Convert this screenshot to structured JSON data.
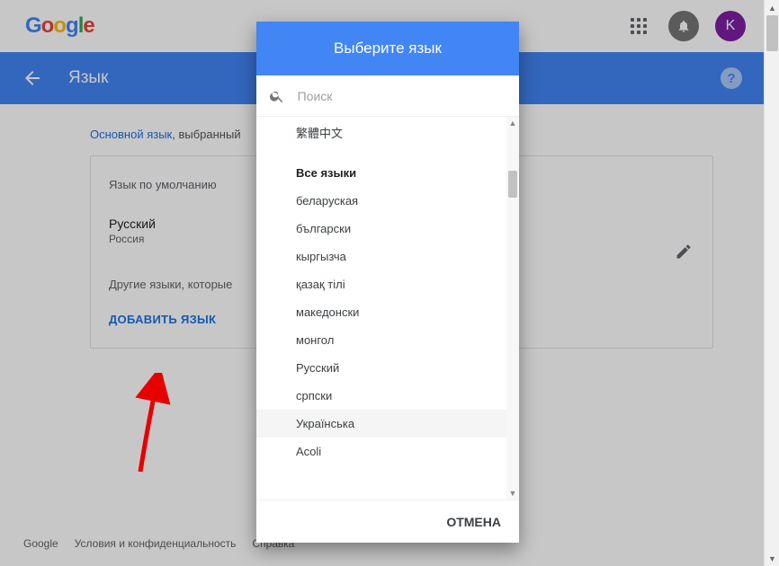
{
  "topbar": {
    "logo_chars": {
      "g1": "G",
      "o1": "o",
      "o2": "o",
      "g2": "g",
      "l1": "l",
      "e1": "e"
    },
    "avatar_initial": "K"
  },
  "header": {
    "title": "Язык"
  },
  "content": {
    "intro_link": "Основной язык",
    "intro_suffix": ", выбранный",
    "card": {
      "heading": "Язык по умолчанию",
      "lang_name": "Русский",
      "lang_sub": "Россия",
      "other_text": "Другие языки, которые",
      "add_label": "ДОБАВИТЬ ЯЗЫК"
    }
  },
  "footer": {
    "brand": "Google",
    "privacy": "Условия и конфиденциальность",
    "help": "Справка"
  },
  "modal": {
    "title": "Выберите язык",
    "search_placeholder": "Поиск",
    "top_item": "繁體中文",
    "section_label": "Все языки",
    "items": [
      "беларуская",
      "български",
      "кыргызча",
      "қазақ тілі",
      "македонски",
      "монгол",
      "Русский",
      "српски",
      "Українська",
      "Acoli"
    ],
    "hover_index": 8,
    "cancel_label": "ОТМЕНА"
  }
}
